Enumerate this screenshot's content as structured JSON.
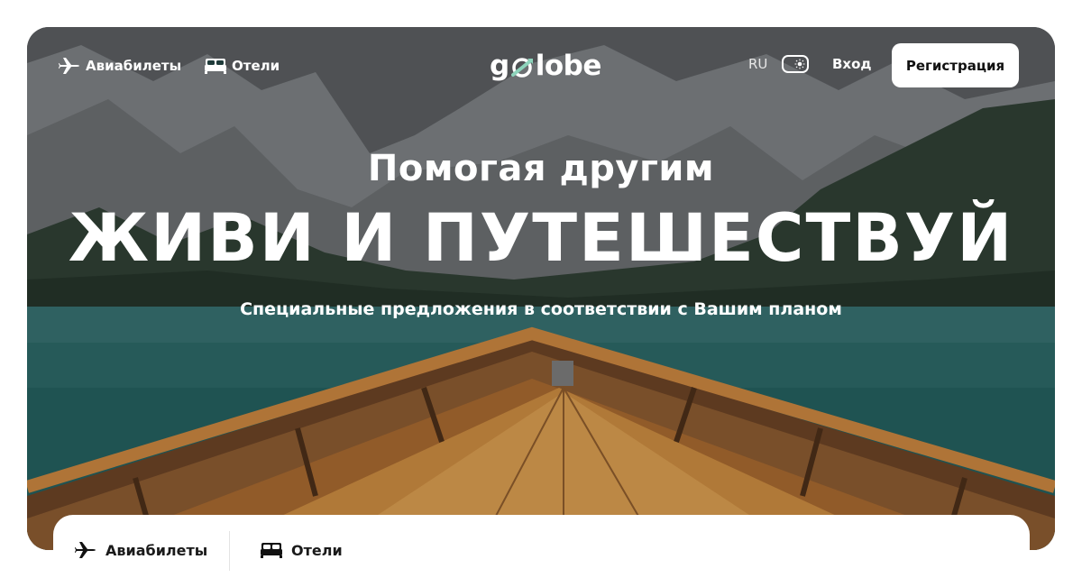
{
  "nav": {
    "flights_label": "Авиабилеты",
    "hotels_label": "Отели",
    "lang": "RU",
    "login_label": "Вход",
    "register_label": "Регистрация"
  },
  "logo": {
    "text_start": "g",
    "text_end": "lobe"
  },
  "hero": {
    "subtitle": "Помогая другим",
    "title": "ЖИВИ И ПУТЕШЕСТВУЙ",
    "tagline": "Специальные предложения в соответствии с Вашим планом"
  },
  "search_tabs": [
    {
      "label": "Авиабилеты",
      "icon": "plane-icon"
    },
    {
      "label": "Отели",
      "icon": "bed-icon"
    }
  ],
  "colors": {
    "accent": "#8dd3bb",
    "water": "#2f6a6a",
    "wood": "#b87a3a"
  }
}
